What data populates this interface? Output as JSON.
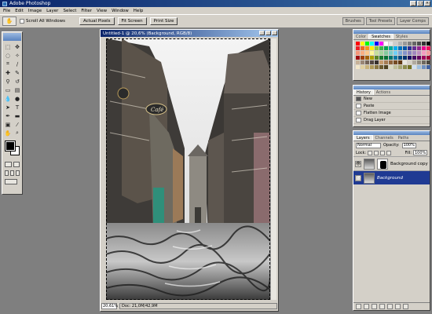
{
  "app": {
    "title": "Adobe Photoshop"
  },
  "menu": [
    "File",
    "Edit",
    "Image",
    "Layer",
    "Select",
    "Filter",
    "View",
    "Window",
    "Help"
  ],
  "options_bar": {
    "scroll_all_windows": "Scroll All Windows",
    "buttons": [
      "Actual Pixels",
      "Fit Screen",
      "Print Size"
    ],
    "palette_well": [
      "Brushes",
      "Tool Presets",
      "Layer Comps"
    ]
  },
  "document": {
    "title": "Untitled-1 @ 20,6% (Background, RGB/8)",
    "zoom": "20,61%",
    "doc_size": "Doc: 21,0M/42,9M"
  },
  "swatches_panel": {
    "tabs": [
      "Color",
      "Swatches",
      "Styles"
    ],
    "active_tab": "Swatches",
    "colors": [
      "#ff0000",
      "#ffff00",
      "#00ff00",
      "#00ffff",
      "#0000ff",
      "#ff00ff",
      "#ffffff",
      "#e6e6e6",
      "#cccccc",
      "#b3b3b3",
      "#999999",
      "#808080",
      "#666666",
      "#4d4d4d",
      "#333333",
      "#000000",
      "#ed1c24",
      "#f26522",
      "#f7941d",
      "#fff200",
      "#8dc63f",
      "#39b54a",
      "#00a651",
      "#00a99d",
      "#00aeef",
      "#0072bc",
      "#0054a6",
      "#2e3192",
      "#662d91",
      "#92278f",
      "#ec008c",
      "#ed145b",
      "#f69679",
      "#f9ad81",
      "#fdc689",
      "#fff799",
      "#c4df9b",
      "#a3d39c",
      "#82ca9c",
      "#7accc8",
      "#6dcff6",
      "#7da7d9",
      "#8393ca",
      "#8781bd",
      "#a187be",
      "#bd8cbf",
      "#f49ac1",
      "#f5989d",
      "#9e0b0f",
      "#a0410d",
      "#a3620a",
      "#aba000",
      "#598527",
      "#1a7b30",
      "#007236",
      "#00746b",
      "#0076a3",
      "#004b80",
      "#003471",
      "#1b1464",
      "#440e62",
      "#630460",
      "#9e005d",
      "#9e0039",
      "#c7b299",
      "#998675",
      "#736357",
      "#534741",
      "#37302d",
      "#c69c6d",
      "#a67c52",
      "#8c6239",
      "#754c24",
      "#603913",
      "#e8e6e0",
      "#d4d0c8",
      "#b0aa9f",
      "#8f897e",
      "#6e685f",
      "#4b463f",
      "#f2e6c8",
      "#e0cfa0",
      "#c9b37a",
      "#b09a5a",
      "#8a7640",
      "#6b5a2e",
      "#4f4220",
      "#d9d9c0",
      "#bfbf99",
      "#a6a673",
      "#8c8c4d",
      "#737326",
      "#d0e0f0",
      "#a0c0e0",
      "#7090c0",
      "#4060a0"
    ]
  },
  "history_panel": {
    "tabs": [
      "History",
      "Actions"
    ],
    "active_tab": "History",
    "items": [
      "New",
      "Paste",
      "Flatten Image",
      "Drag Layer"
    ]
  },
  "layers_panel": {
    "tabs": [
      "Layers",
      "Channels",
      "Paths"
    ],
    "active_tab": "Layers",
    "blend_mode": "Normal",
    "opacity_label": "Opacity:",
    "opacity": "100%",
    "lock_label": "Lock:",
    "fill_label": "Fill:",
    "fill": "100%",
    "layers": [
      {
        "name": "Background copy",
        "selected": false,
        "has_mask": true
      },
      {
        "name": "Background",
        "selected": true,
        "has_mask": false
      }
    ]
  }
}
